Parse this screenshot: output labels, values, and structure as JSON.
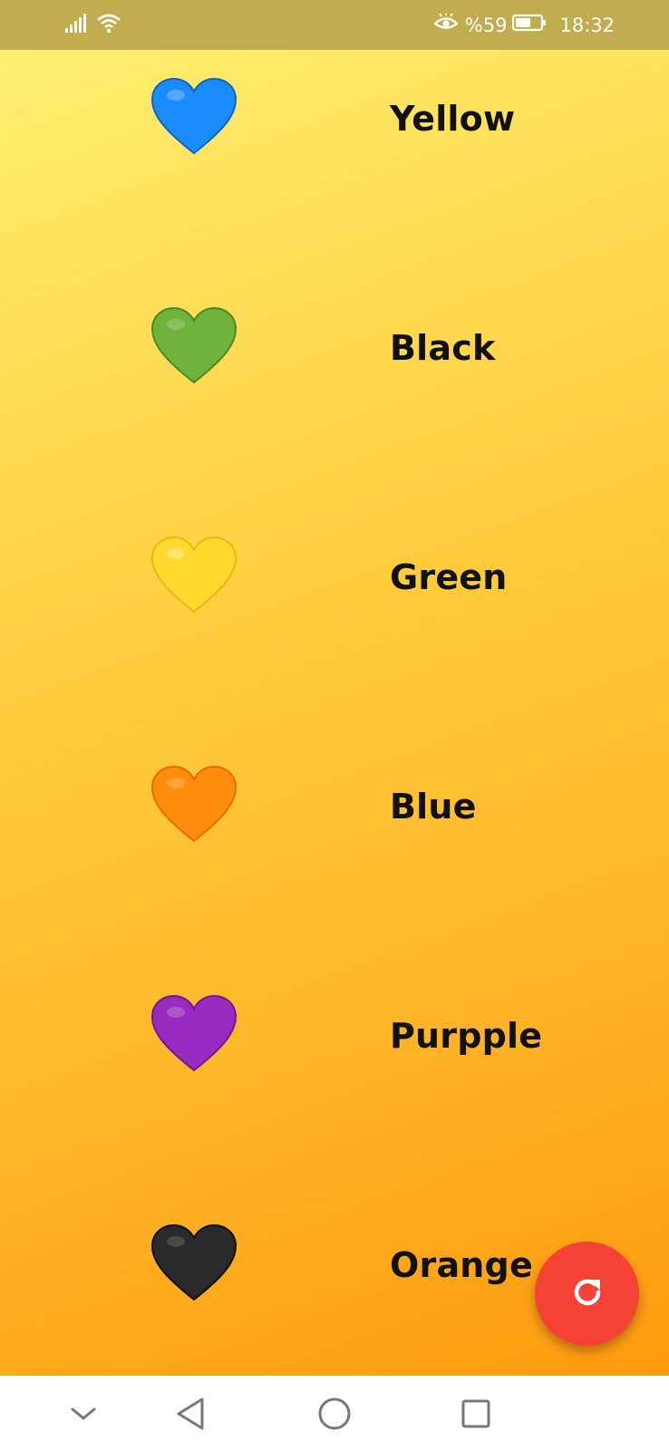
{
  "status_bar": {
    "battery_percent": "%59",
    "time": "18:32",
    "icons": [
      "signal-icon",
      "wifi-icon",
      "eye-comfort-icon",
      "battery-icon"
    ]
  },
  "rows": [
    {
      "label": "Yellow",
      "heart_color": "#1a8cff",
      "heart_shade": "#0b62c9",
      "heart_icon": "blue-heart-icon"
    },
    {
      "label": "Black",
      "heart_color": "#6fb23c",
      "heart_shade": "#4a8a24",
      "heart_icon": "green-heart-icon"
    },
    {
      "label": "Green",
      "heart_color": "#ffd92e",
      "heart_shade": "#e8b90f",
      "heart_icon": "yellow-heart-icon"
    },
    {
      "label": "Blue",
      "heart_color": "#ff8c0a",
      "heart_shade": "#e06d00",
      "heart_icon": "orange-heart-icon"
    },
    {
      "label": "Purpple",
      "heart_color": "#9a2bc0",
      "heart_shade": "#6e1a96",
      "heart_icon": "purple-heart-icon"
    },
    {
      "label": "Orange",
      "heart_color": "#2a2a2a",
      "heart_shade": "#0f0f0f",
      "heart_icon": "black-heart-icon"
    }
  ],
  "fab": {
    "icon": "refresh-icon",
    "color": "#f44336"
  },
  "nav_bar": {
    "icons": [
      "chevron-down-icon",
      "back-icon",
      "home-icon",
      "recents-icon"
    ]
  }
}
